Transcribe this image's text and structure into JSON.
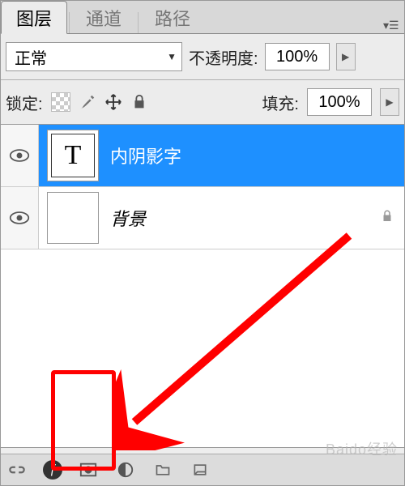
{
  "tabs": {
    "layers": "图层",
    "channels": "通道",
    "paths": "路径"
  },
  "blend_mode": "正常",
  "opacity": {
    "label": "不透明度:",
    "value": "100%"
  },
  "lock_label": "锁定:",
  "fill": {
    "label": "填充:",
    "value": "100%"
  },
  "layers": [
    {
      "name": "内阴影字",
      "thumb_letter": "T",
      "selected": true,
      "locked": false
    },
    {
      "name": "背景",
      "thumb_letter": "",
      "selected": false,
      "locked": true,
      "italic": true
    }
  ],
  "watermark": "Baido经验"
}
